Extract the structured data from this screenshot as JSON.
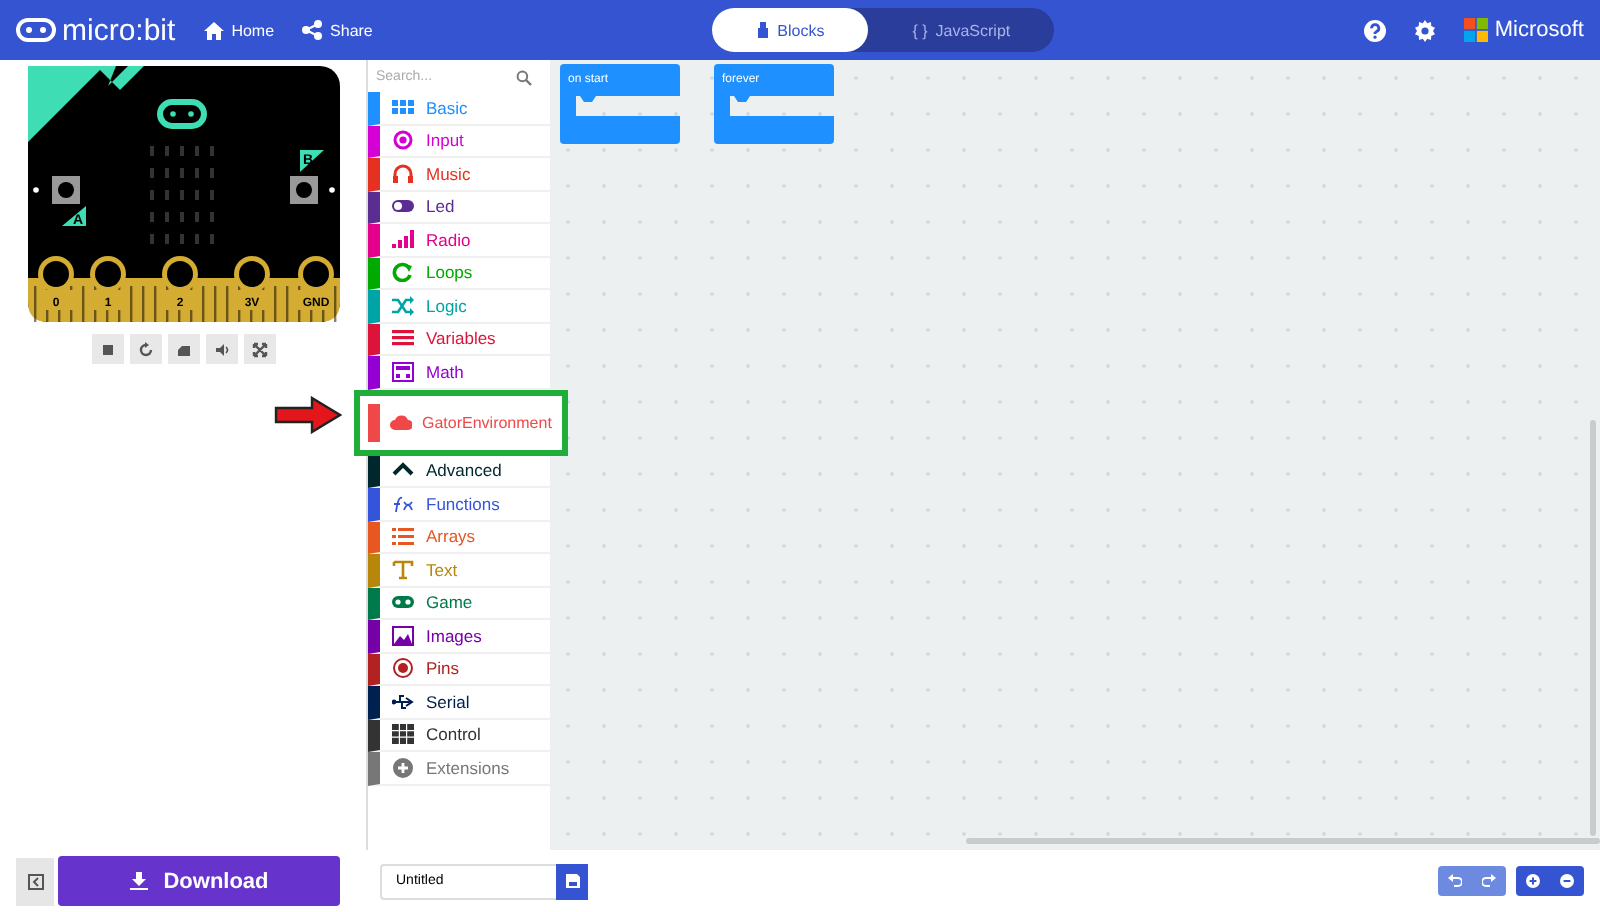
{
  "header": {
    "brand": "micro:bit",
    "nav": [
      {
        "label": "Home"
      },
      {
        "label": "Share"
      }
    ],
    "editor_toggle": [
      {
        "label": "Blocks",
        "selected": true
      },
      {
        "label": "JavaScript",
        "icon_text": "{ }",
        "selected": false
      }
    ],
    "company": "Microsoft"
  },
  "simulator": {
    "pins": [
      "0",
      "1",
      "2",
      "3V",
      "GND"
    ],
    "button_labels": [
      "A",
      "B"
    ]
  },
  "toolbox": {
    "search": {
      "placeholder": "Search..."
    },
    "categories": [
      {
        "label": "Basic",
        "color": "#1e90ff"
      },
      {
        "label": "Input",
        "color": "#d400d4"
      },
      {
        "label": "Music",
        "color": "#e63022"
      },
      {
        "label": "Led",
        "color": "#5c2d91"
      },
      {
        "label": "Radio",
        "color": "#e3008c"
      },
      {
        "label": "Loops",
        "color": "#00aa00"
      },
      {
        "label": "Logic",
        "color": "#00a4a6"
      },
      {
        "label": "Variables",
        "color": "#dc143c"
      },
      {
        "label": "Math",
        "color": "#9400d3"
      },
      {
        "label": "GatorEnvironment",
        "color": "#f04848",
        "annotated": true
      },
      {
        "label": "Advanced",
        "color": "#00272b"
      },
      {
        "label": "Functions",
        "color": "#3455db"
      },
      {
        "label": "Arrays",
        "color": "#e65722"
      },
      {
        "label": "Text",
        "color": "#b8860b"
      },
      {
        "label": "Game",
        "color": "#007a4b"
      },
      {
        "label": "Images",
        "color": "#7600a8"
      },
      {
        "label": "Pins",
        "color": "#b22222"
      },
      {
        "label": "Serial",
        "color": "#002050"
      },
      {
        "label": "Control",
        "color": "#333333"
      },
      {
        "label": "Extensions",
        "color": "#777777"
      }
    ]
  },
  "workspace": {
    "blocks": [
      {
        "label": "on start"
      },
      {
        "label": "forever"
      }
    ]
  },
  "footer": {
    "download": "Download",
    "project_name": "Untitled"
  }
}
